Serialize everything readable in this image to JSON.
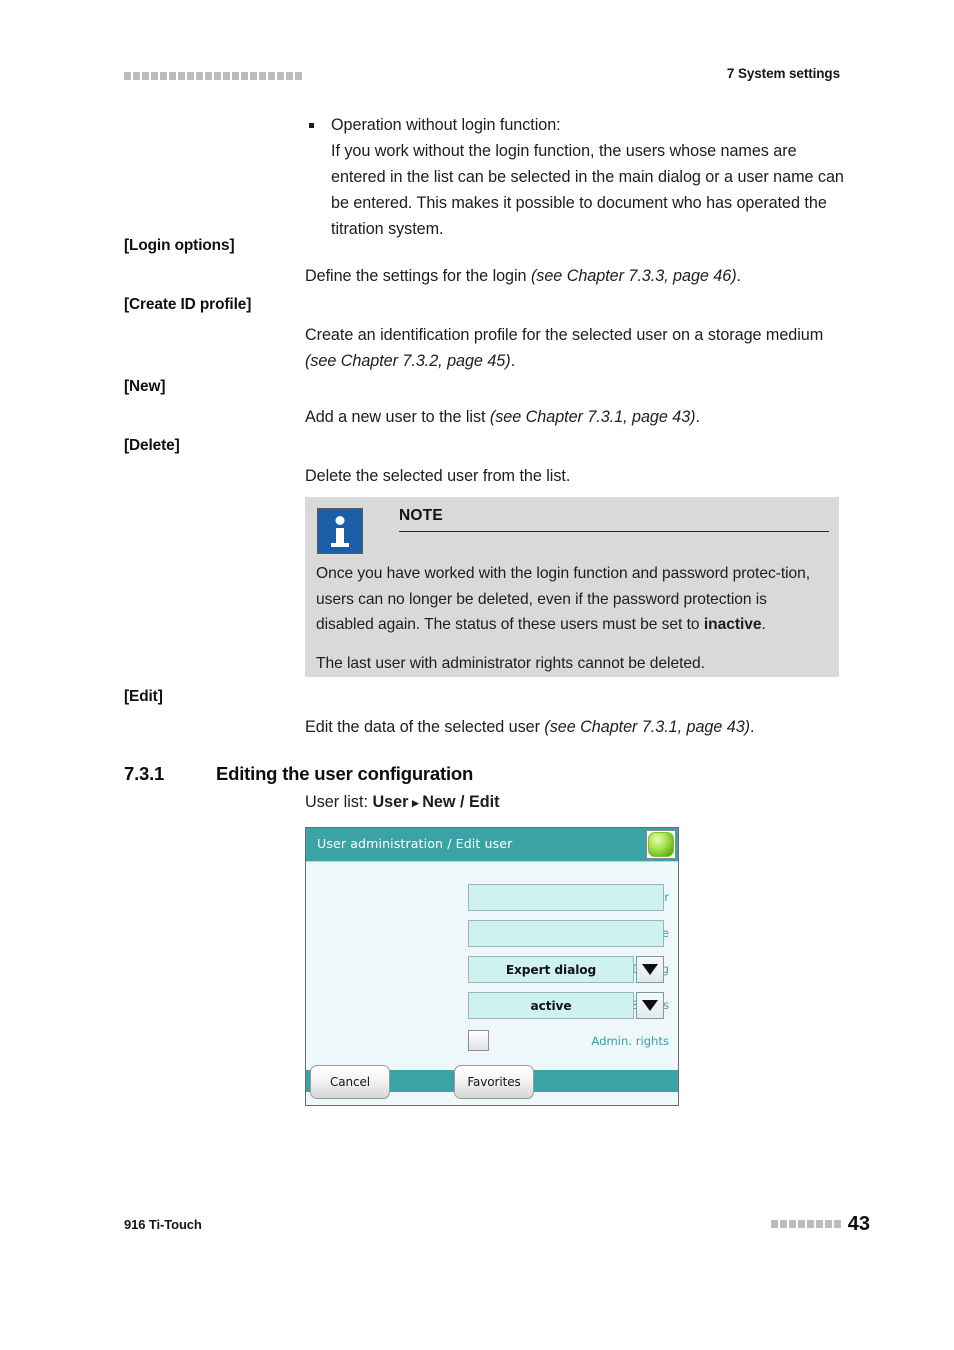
{
  "header": {
    "dingbat_count": 20,
    "section_title": "7 System settings"
  },
  "intro_bullet": {
    "line1": "Operation without login function:",
    "line2": "If you work without the login function, the users whose names are entered in the list can be selected in the main dialog or a user name can be entered. This makes it possible to document who has operated the titration system."
  },
  "entries": [
    {
      "term": "[Login options]",
      "text": "Define the settings for the login ",
      "ref": "(see Chapter 7.3.3, page 46)",
      "tail": "."
    },
    {
      "term": "[Create ID profile]",
      "text": "Create an identification profile for the selected user on a storage medium ",
      "ref": "(see Chapter 7.3.2, page 45)",
      "tail": "."
    },
    {
      "term": "[New]",
      "text": "Add a new user to the list ",
      "ref": "(see Chapter 7.3.1, page 43)",
      "tail": "."
    },
    {
      "term": "[Delete]",
      "text": "Delete the selected user from the list.",
      "ref": "",
      "tail": ""
    },
    {
      "term": "[Edit]",
      "text": "Edit the data of the selected user ",
      "ref": "(see Chapter 7.3.1, page 43)",
      "tail": "."
    }
  ],
  "note": {
    "icon": "info-icon",
    "title": "NOTE",
    "paragraph1_a": "Once you have worked with the login function and password protec-tion, users can no longer be deleted, even if the password protection is disabled again. The status of these users must be set to ",
    "paragraph1_bold": "inactive",
    "paragraph1_b": ".",
    "paragraph2": "The last user with administrator rights cannot be deleted.",
    "background_color": "#d9d9d9",
    "icon_color": "#1b5ea8"
  },
  "section": {
    "number": "7.3.1",
    "title": "Editing the user configuration",
    "path_prefix": "User list: ",
    "path_part1": "User",
    "path_arrow": "▸",
    "path_part2": "New / Edit"
  },
  "device_dialog": {
    "title": "User administration / Edit user",
    "home_button": "home-button",
    "accent_color": "#3ba3a6",
    "field_color": "#cef2f2",
    "body_color": "#eef7f9",
    "fields": [
      {
        "label": "User",
        "type": "text",
        "value": ""
      },
      {
        "label": "Full name",
        "type": "text",
        "value": ""
      },
      {
        "label": "Dialog",
        "type": "select",
        "value": "Expert dialog"
      },
      {
        "label": "Status",
        "type": "select",
        "value": "active"
      },
      {
        "label": "Admin. rights",
        "type": "checkbox",
        "value": ""
      }
    ],
    "buttons": [
      {
        "label": "Cancel"
      },
      {
        "label": "Favorites"
      }
    ]
  },
  "footer": {
    "product": "916 Ti-Touch",
    "dingbat_count": 8,
    "page_number": "43"
  }
}
